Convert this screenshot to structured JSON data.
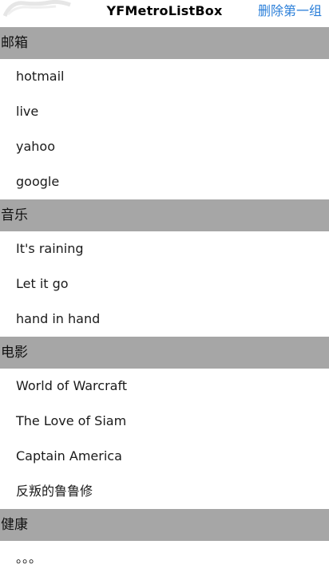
{
  "nav": {
    "title": "YFMetroListBox",
    "right_button": "删除第一组",
    "accent_color": "#2b7fd9"
  },
  "sections": [
    {
      "header": "邮箱",
      "rows": [
        "hotmail",
        "live",
        "yahoo",
        "google"
      ]
    },
    {
      "header": "音乐",
      "rows": [
        "It's raining",
        "Let it go",
        "hand in hand"
      ]
    },
    {
      "header": "电影",
      "rows": [
        "World of Warcraft",
        "The Love of Siam",
        "Captain America",
        "反叛的鲁鲁修"
      ]
    },
    {
      "header": "健康",
      "rows": [
        "。。。"
      ]
    }
  ]
}
